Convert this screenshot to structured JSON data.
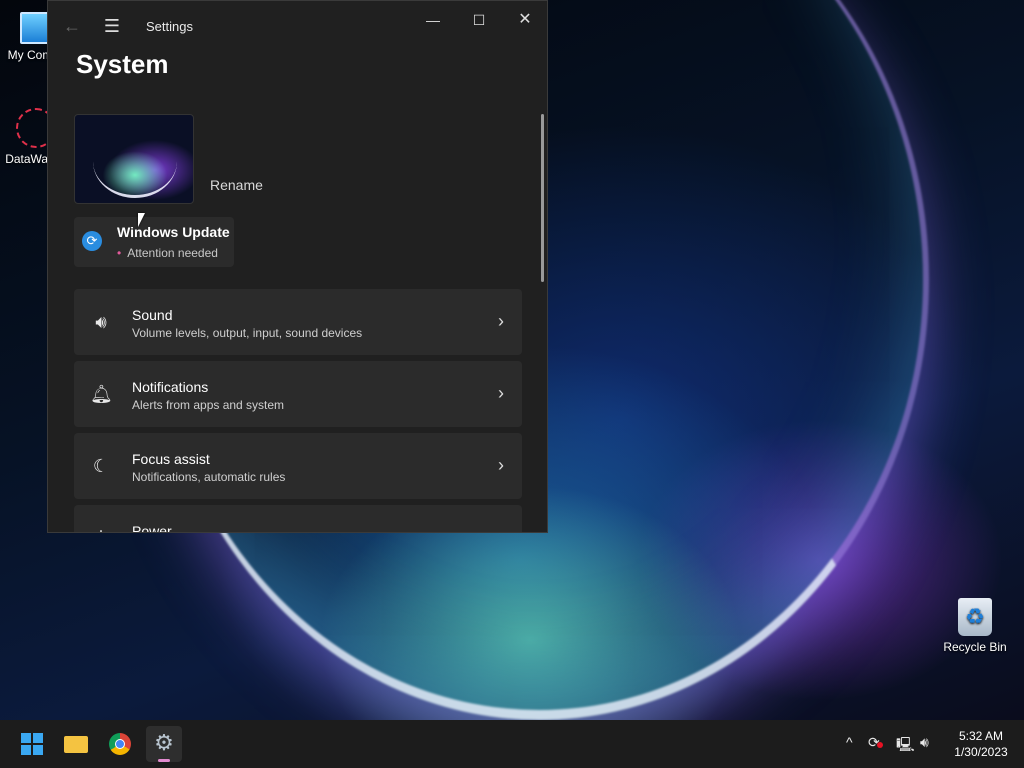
{
  "desktop": {
    "icons": {
      "my_computer": "My Com",
      "datawag": "DataWag",
      "recycle_bin": "Recycle Bin"
    }
  },
  "window": {
    "title": "Settings",
    "page_title": "System",
    "rename": "Rename",
    "windows_update": {
      "title": "Windows Update",
      "status": "Attention needed"
    },
    "rows": [
      {
        "title": "Sound",
        "subtitle": "Volume levels, output, input, sound devices",
        "icon": "speaker-icon"
      },
      {
        "title": "Notifications",
        "subtitle": "Alerts from apps and system",
        "icon": "bell-icon"
      },
      {
        "title": "Focus assist",
        "subtitle": "Notifications, automatic rules",
        "icon": "moon-icon"
      },
      {
        "title": "Power",
        "subtitle": "",
        "icon": "power-icon"
      }
    ]
  },
  "taskbar": {
    "apps": [
      "start-icon",
      "file-explorer-icon",
      "chrome-icon",
      "settings-gear-icon"
    ],
    "clock": {
      "time": "5:32 AM",
      "date": "1/30/2023"
    }
  },
  "colors": {
    "window_bg": "#202020",
    "card_bg": "#2b2b2b",
    "taskbar_bg": "#1c1c1c",
    "accent": "#3aa8f2",
    "attention_dot": "#e25a9b"
  }
}
